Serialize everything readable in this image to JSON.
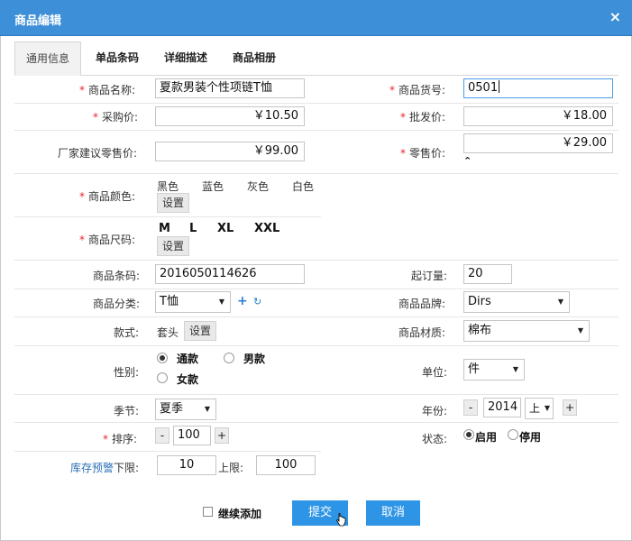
{
  "dialog": {
    "title": "商品编辑",
    "close_glyph": "×"
  },
  "tabs": [
    {
      "label": "通用信息",
      "active": true
    },
    {
      "label": "单品条码",
      "active": false
    },
    {
      "label": "详细描述",
      "active": false
    },
    {
      "label": "商品相册",
      "active": false
    }
  ],
  "form": {
    "required_mark": "*",
    "name": {
      "label": "商品名称:",
      "value": "夏款男装个性项链T恤"
    },
    "sku": {
      "label": "商品货号:",
      "value": "0501"
    },
    "purchase_price": {
      "label": "采购价:",
      "value": "￥10.50"
    },
    "wholesale_price": {
      "label": "批发价:",
      "value": "￥18.00"
    },
    "msrp": {
      "label": "厂家建议零售价:",
      "value": "￥99.00"
    },
    "retail_price": {
      "label": "零售价:",
      "value": "￥29.00"
    },
    "colors": {
      "label": "商品颜色:",
      "options": [
        "黑色",
        "蓝色",
        "灰色",
        "白色"
      ],
      "set_button": "设置"
    },
    "sizes": {
      "label": "商品尺码:",
      "options": [
        "M",
        "L",
        "XL",
        "XXL"
      ],
      "set_button": "设置"
    },
    "barcode": {
      "label": "商品条码:",
      "value": "2016050114626"
    },
    "min_order": {
      "label": "起订量:",
      "value": "20"
    },
    "category": {
      "label": "商品分类:",
      "value": "T恤"
    },
    "brand": {
      "label": "商品品牌:",
      "value": "Dirs"
    },
    "style": {
      "label": "款式:",
      "value": "套头",
      "set_button": "设置"
    },
    "material": {
      "label": "商品材质:",
      "value": "棉布"
    },
    "gender": {
      "label": "性别:",
      "options": [
        "通款",
        "男款",
        "女款"
      ],
      "selected": "通款"
    },
    "unit": {
      "label": "单位:",
      "value": "件"
    },
    "season": {
      "label": "季节:",
      "value": "夏季"
    },
    "year": {
      "label": "年份:",
      "value": "2014",
      "half": "上",
      "minus": "-",
      "plus": "+"
    },
    "sort": {
      "label": "排序:",
      "value": "100",
      "minus": "-",
      "plus": "+"
    },
    "status": {
      "label": "状态:",
      "options": [
        "启用",
        "停用"
      ],
      "selected": "启用"
    },
    "stock_alert": {
      "label": "库存预警",
      "lower_label": "下限:",
      "lower": "10",
      "upper_label": "上限:",
      "upper": "100"
    }
  },
  "footer": {
    "continue_label": "继续添加",
    "submit": "提交",
    "cancel": "取消"
  },
  "icons": {
    "dropdown": "▼",
    "add": "+",
    "refresh": "↻",
    "expand": "⌃"
  },
  "colors": {
    "titlebar": "#3d8fd7",
    "primary_button": "#2e95e6",
    "required": "#e22233"
  }
}
